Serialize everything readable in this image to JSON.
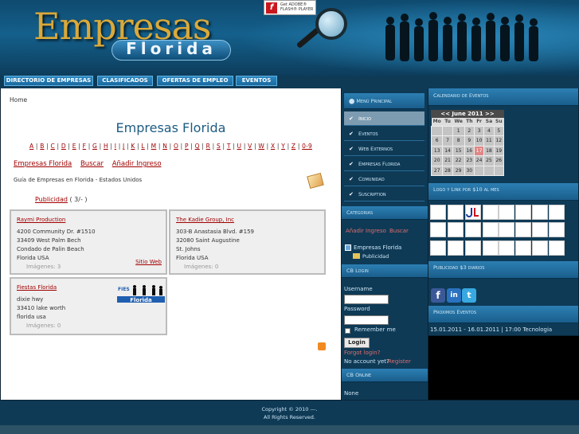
{
  "header": {
    "logo_line1": "Empresas",
    "logo_line2": "Florida",
    "flash_text": "Get ADOBE® FLASH® PLAYER",
    "flash_letter": "f"
  },
  "nav": [
    "DIRECTORIO DE EMPRESAS",
    "CLASIFICADOS",
    "OFERTAS DE EMPLEO",
    "EVENTOS"
  ],
  "main": {
    "breadcrumb": "Home",
    "title": "Empresas Florida",
    "alphabet": [
      "A",
      "B",
      "C",
      "D",
      "E",
      "F",
      "G",
      "H",
      "I",
      "J",
      "K",
      "L",
      "M",
      "N",
      "O",
      "P",
      "Q",
      "R",
      "S",
      "T",
      "U",
      "V",
      "W",
      "X",
      "Y",
      "Z",
      "0-9"
    ],
    "links": [
      "Empresas Florida",
      "Buscar",
      "Añadir Ingreso"
    ],
    "guide": "Guía de Empresas en Florida - Estados Unidos",
    "publicidad_label": "Publicidad",
    "publicidad_count": "( 3/- )",
    "listings": [
      {
        "name": "Raymi Production",
        "lines": [
          "4200 Community Dr. #1510",
          "33409    West Palm Bech",
          "Condado de Palin Beach",
          "Florida    USA"
        ],
        "images": "Imágenes: 3",
        "web": "Sitio Web"
      },
      {
        "name": "The Kadie Group, Inc",
        "lines": [
          "303-B Anastasia Blvd. #159",
          "32080    Saint Augustine",
          "St. Johns",
          "Florida    USA"
        ],
        "images": "Imágenes: 0"
      },
      {
        "name": "Fiestas Florida",
        "lines": [
          "dixie hwy",
          "33410    lake worth",
          "florida    usa"
        ],
        "images": "Imágenes: 0",
        "logo_text": "Fiestas Florida"
      }
    ]
  },
  "left": {
    "menu_title": "Menú Principal",
    "menu": [
      "Inicio",
      "Eventos",
      "Web Externos",
      "Empresas Florida",
      "Comunidad",
      "Suscription"
    ],
    "cat_title": "Categorias",
    "cat_links": [
      "Añadir Ingreso",
      "Buscar"
    ],
    "cat_tree": [
      "Empresas Florida",
      "Publicidad"
    ],
    "login_title": "CB Login",
    "username_label": "Username",
    "password_label": "Password",
    "remember_label": "Remember me",
    "login_button": "Login",
    "forgot": "Forgot login?",
    "no_account": "No account yet?",
    "register": "Register",
    "online_title": "CB Online",
    "online_value": "None"
  },
  "right": {
    "cal_title": "Calendario de Eventos",
    "cal_month": "<<   June 2011   >>",
    "cal_days": [
      "Mo",
      "Tu",
      "We",
      "Th",
      "Fr",
      "Sa",
      "Su"
    ],
    "cal_rows": [
      [
        "",
        "",
        "1",
        "2",
        "3",
        "4",
        "5"
      ],
      [
        "6",
        "7",
        "8",
        "9",
        "10",
        "11",
        "12"
      ],
      [
        "13",
        "14",
        "15",
        "16",
        "17",
        "18",
        "19"
      ],
      [
        "20",
        "21",
        "22",
        "23",
        "24",
        "25",
        "26"
      ],
      [
        "27",
        "28",
        "29",
        "30",
        "",
        "",
        ""
      ]
    ],
    "cal_today": "17",
    "logo_title": "Logo y Link por $10 al mes",
    "pub_title": "Publicidad $3 diarios",
    "events_title": "Proximos Eventos",
    "event_text": "15.01.2011 - 16.01.2011 | 17:00 Tecnologia"
  },
  "footer": {
    "copyright": "Copyright © 2010 ---.",
    "rights": "All Rights Reserved."
  }
}
